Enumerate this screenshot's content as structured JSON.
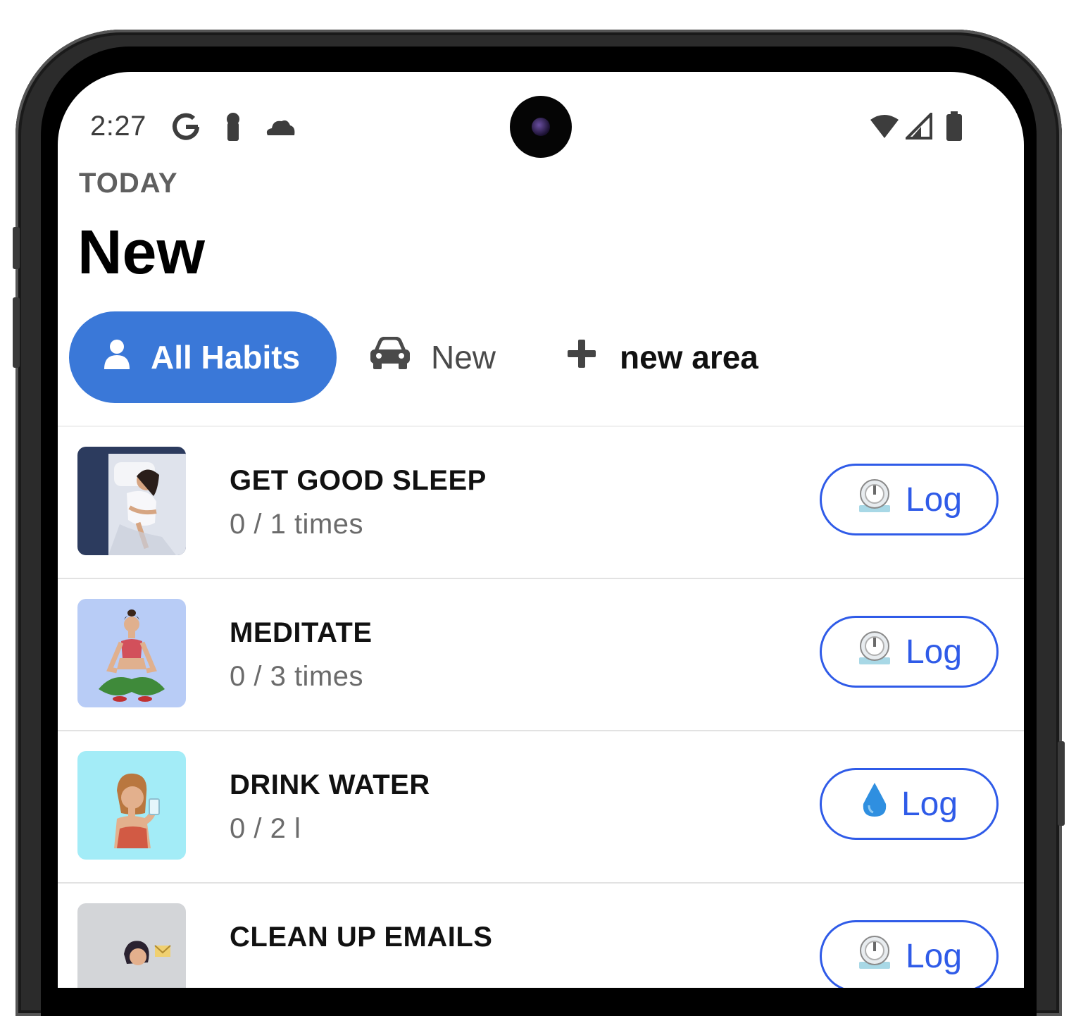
{
  "status_bar": {
    "time": "2:27",
    "left_icons": [
      "google-icon",
      "keyhole-icon",
      "cloud-icon"
    ],
    "right_icons": [
      "wifi-icon",
      "signal-icon",
      "battery-icon"
    ]
  },
  "header": {
    "overline": "TODAY",
    "title": "New"
  },
  "filters": [
    {
      "label": "All Habits",
      "icon": "person-icon",
      "active": true
    },
    {
      "label": "New",
      "icon": "car-icon",
      "active": false
    },
    {
      "label": "new area",
      "icon": "plus-icon",
      "active": false
    }
  ],
  "habits": [
    {
      "name": "GET GOOD SLEEP",
      "progress": "0 / 1 times",
      "log_label": "Log",
      "log_icon": "timer-icon",
      "thumb": "sleeping-woman"
    },
    {
      "name": "MEDITATE",
      "progress": "0 / 3 times",
      "log_label": "Log",
      "log_icon": "timer-icon",
      "thumb": "meditating-woman"
    },
    {
      "name": "DRINK WATER",
      "progress": "0 / 2 l",
      "log_label": "Log",
      "log_icon": "water-drop-icon",
      "thumb": "drinking-woman"
    },
    {
      "name": "CLEAN UP EMAILS",
      "progress": "",
      "log_label": "Log",
      "log_icon": "timer-icon",
      "thumb": "woman-with-emails"
    }
  ],
  "colors": {
    "accent": "#3a78d8",
    "log_border": "#2f5be8",
    "thumb_sleep_bg": "#2c3b5e",
    "thumb_meditate_bg": "#b8ccf6",
    "thumb_water_bg": "#a3ecf7",
    "thumb_email_bg": "#d3d5d8"
  }
}
